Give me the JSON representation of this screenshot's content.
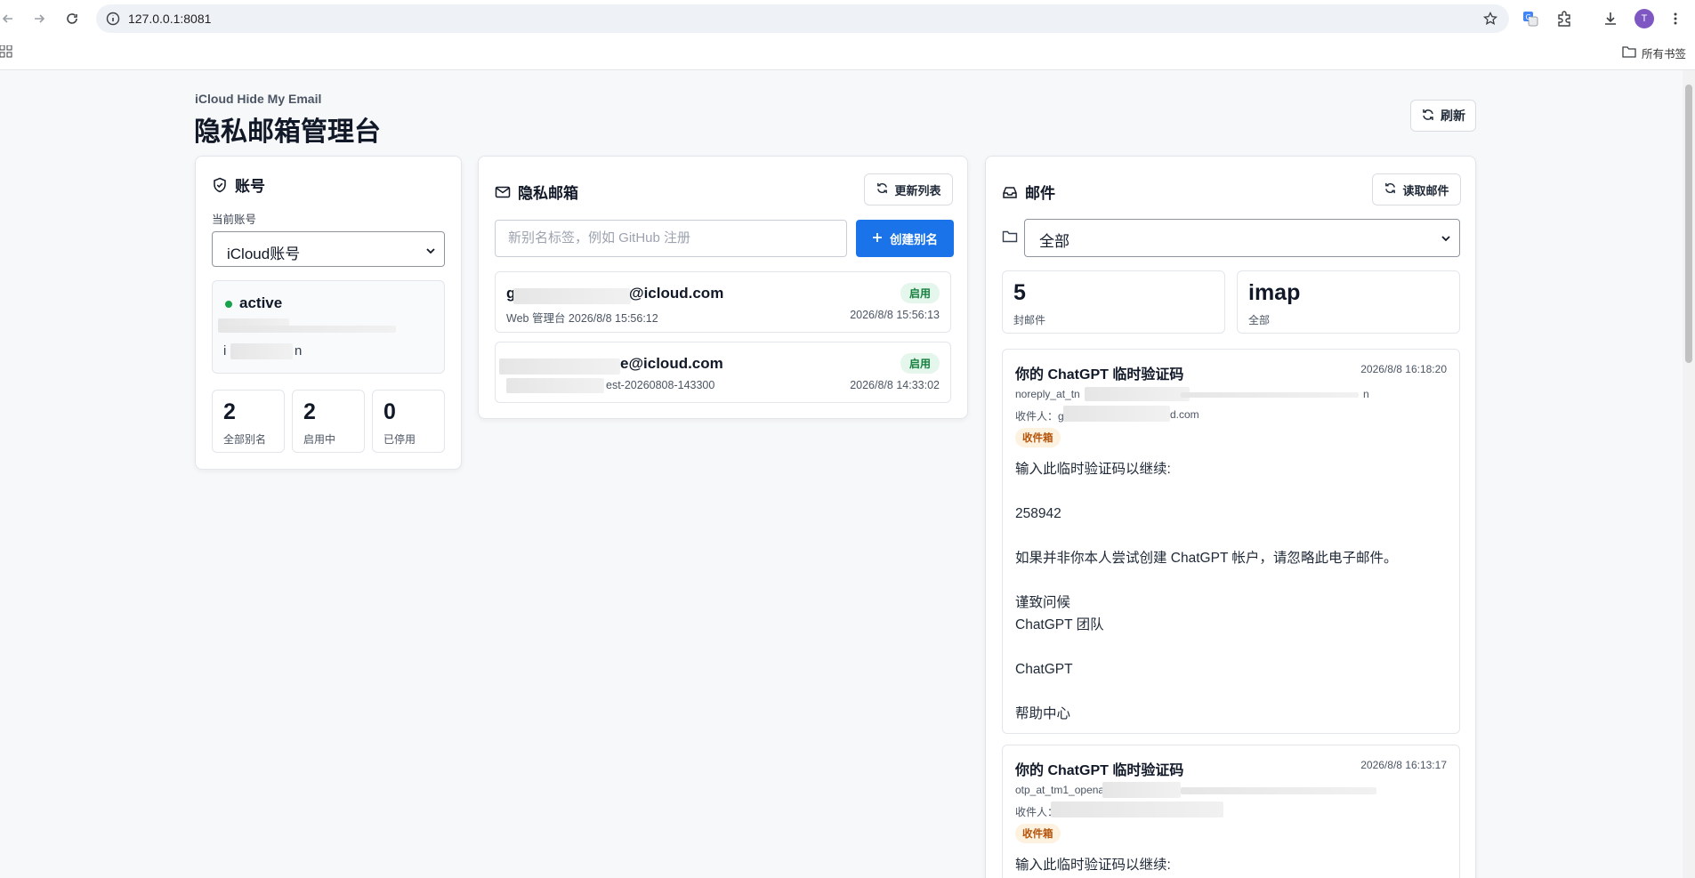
{
  "browser": {
    "url": "127.0.0.1:8081",
    "avatar_letter": "T",
    "bookmarks_all": "所有书签"
  },
  "header": {
    "brand": "iCloud Hide My Email",
    "title": "隐私邮箱管理台",
    "refresh_label": "刷新"
  },
  "account": {
    "title": "账号",
    "current_label": "当前账号",
    "selected": "iCloud账号",
    "status": "active",
    "line2_start": "i",
    "line2_end": "n",
    "stats": [
      {
        "value": "2",
        "label": "全部别名"
      },
      {
        "value": "2",
        "label": "启用中"
      },
      {
        "value": "0",
        "label": "已停用"
      }
    ]
  },
  "aliases": {
    "title": "隐私邮箱",
    "update_label": "更新列表",
    "input_placeholder": "新别名标签，例如 GitHub 注册",
    "create_label": "创建别名",
    "items": [
      {
        "email_prefix": "g",
        "email_suffix": "@icloud.com",
        "sub": "Web 管理台 2026/8/8 15:56:12",
        "time": "2026/8/8 15:56:13",
        "status": "启用"
      },
      {
        "email_prefix": "",
        "email_suffix": "e@icloud.com",
        "sub_prefix": "(",
        "sub": "est-20260808-143300",
        "time": "2026/8/8 14:33:02",
        "status": "启用"
      }
    ]
  },
  "mail": {
    "title": "邮件",
    "read_label": "读取邮件",
    "folder_selected": "全部",
    "stats": [
      {
        "value": "5",
        "label": "封邮件"
      },
      {
        "value": "imap",
        "label": "全部"
      }
    ],
    "messages": [
      {
        "subject": "你的 ChatGPT 临时验证码",
        "time": "2026/8/8 16:18:20",
        "from_start": "noreply_at_tn",
        "from_end": "n",
        "to_start": "收件人：g",
        "to_end": "d.com",
        "folder": "收件箱",
        "body": "输入此临时验证码以继续:\n\n258942\n\n如果并非你本人尝试创建 ChatGPT 帐户，请忽略此电子邮件。\n\n谨致问候\nChatGPT 团队\n\nChatGPT\n\n帮助中心"
      },
      {
        "subject": "你的 ChatGPT 临时验证码",
        "time": "2026/8/8 16:13:17",
        "from_start": "otp_at_tm1_openai",
        "from_end": "",
        "to_start": "收件人：",
        "to_end": "",
        "folder": "收件箱",
        "body": "输入此临时验证码以继续:"
      }
    ]
  }
}
